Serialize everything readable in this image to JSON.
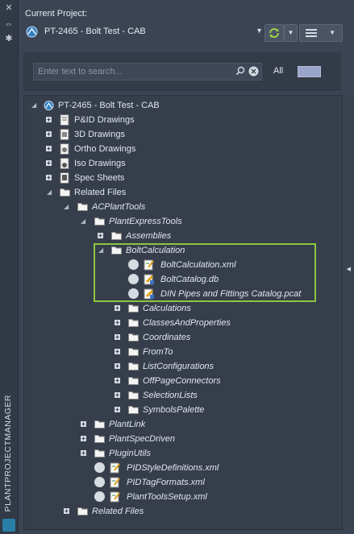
{
  "side_panel": {
    "vertical_title": "PLANTPROJECTMANAGER",
    "buttons": [
      "close-icon",
      "pin-icon",
      "settings-icon"
    ]
  },
  "header": {
    "current_project_label": "Current Project:",
    "project_name": "PT-2465 - Bolt Test - CAB"
  },
  "search": {
    "placeholder": "Enter text to search...",
    "filter_label": "All"
  },
  "tree": {
    "root": "PT-2465 - Bolt Test - CAB",
    "nodes": [
      {
        "label": "P&ID Drawings"
      },
      {
        "label": "3D Drawings"
      },
      {
        "label": "Ortho Drawings"
      },
      {
        "label": "Iso Drawings"
      },
      {
        "label": "Spec Sheets"
      },
      {
        "label": "Related Files"
      },
      {
        "label": "ACPlantTools"
      },
      {
        "label": "PlantExpressTools"
      },
      {
        "label": "Assemblies"
      },
      {
        "label": "BoltCalculation"
      },
      {
        "label": "BoltCalculation.xml"
      },
      {
        "label": "BoltCatalog.db"
      },
      {
        "label": "DIN Pipes and Fittings Catalog.pcat"
      },
      {
        "label": "Calculations"
      },
      {
        "label": "ClassesAndProperties"
      },
      {
        "label": "Coordinates"
      },
      {
        "label": "FromTo"
      },
      {
        "label": "ListConfigurations"
      },
      {
        "label": "OffPageConnectors"
      },
      {
        "label": "SelectionLists"
      },
      {
        "label": "SymbolsPalette"
      },
      {
        "label": "PlantLink"
      },
      {
        "label": "PlantSpecDriven"
      },
      {
        "label": "PluginUtils"
      },
      {
        "label": "PIDStyleDefinitions.xml"
      },
      {
        "label": "PIDTagFormats.xml"
      },
      {
        "label": "PlantToolsSetup.xml"
      },
      {
        "label": "Related Files"
      }
    ]
  },
  "colors": {
    "background": "#3b4453",
    "tree_background": "#363e4b",
    "highlight_border": "#8cc63f",
    "text": "#e2e6ec"
  }
}
